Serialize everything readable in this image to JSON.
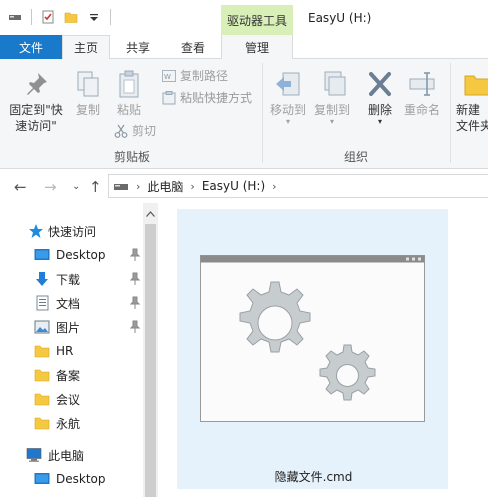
{
  "titlebar": {
    "context_tab": "驱动器工具",
    "window_title": "EasyU (H:)"
  },
  "tabs": {
    "file": "文件",
    "home": "主页",
    "share": "共享",
    "view": "查看",
    "manage": "管理"
  },
  "ribbon": {
    "pin_quick_access": "固定到\"快速访问\"",
    "copy": "复制",
    "paste": "粘贴",
    "copy_path": "复制路径",
    "paste_shortcut": "粘贴快捷方式",
    "cut": "剪切",
    "clipboard_group": "剪贴板",
    "move_to": "移动到",
    "copy_to": "复制到",
    "delete": "删除",
    "rename": "重命名",
    "organize_group": "组织",
    "new_folder_line1": "新建",
    "new_folder_line2": "文件夹"
  },
  "address": {
    "crumbs": [
      "此电脑",
      "EasyU (H:)"
    ]
  },
  "navpane": {
    "quick_access": "快速访问",
    "items": [
      {
        "label": "Desktop",
        "icon": "desktop-icon",
        "pinned": true
      },
      {
        "label": "下载",
        "icon": "download-icon",
        "pinned": true
      },
      {
        "label": "文档",
        "icon": "documents-icon",
        "pinned": true
      },
      {
        "label": "图片",
        "icon": "pictures-icon",
        "pinned": true
      },
      {
        "label": "HR",
        "icon": "folder-icon",
        "pinned": false
      },
      {
        "label": "备案",
        "icon": "folder-icon",
        "pinned": false
      },
      {
        "label": "会议",
        "icon": "folder-icon",
        "pinned": false
      },
      {
        "label": "永航",
        "icon": "folder-icon",
        "pinned": false
      }
    ],
    "this_pc": "此电脑",
    "this_pc_desktop": "Desktop"
  },
  "content": {
    "file_name": "隐藏文件.cmd",
    "file_icon": "gears-script-icon"
  },
  "colors": {
    "file_tab": "#1979ca",
    "context_tab": "#d8f0b8",
    "selection": "#e5f1fb"
  }
}
